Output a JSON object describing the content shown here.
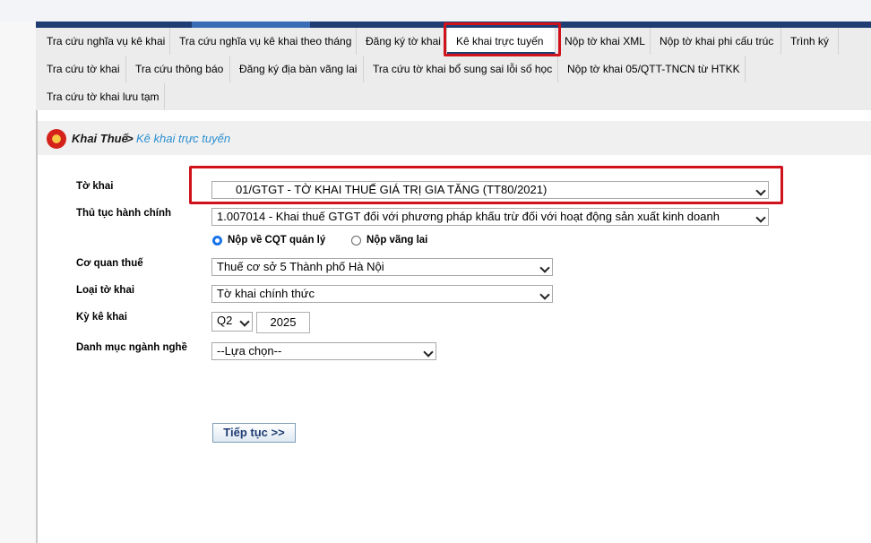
{
  "tabs_row1": [
    "Tra cứu nghĩa vụ kê khai",
    "Tra cứu nghĩa vụ kê khai theo tháng",
    "Đăng ký tờ khai",
    "Kê khai trực tuyến",
    "Nộp tờ khai XML",
    "Nộp tờ khai phi cấu trúc",
    "Trình ký"
  ],
  "tabs_row2": [
    "Tra cứu tờ khai",
    "Tra cứu thông báo",
    "Đăng ký địa bàn vãng lai",
    "Tra cứu tờ khai bổ sung sai lỗi số học",
    "Nộp tờ khai 05/QTT-TNCN từ HTKK"
  ],
  "tabs_row3": [
    "Tra cứu tờ khai lưu tạm"
  ],
  "breadcrumb": {
    "root": "Khai Thuế",
    "sep": ">",
    "current": "Kê khai trực tuyến"
  },
  "form": {
    "to_khai_label": "Tờ khai",
    "to_khai_value": "01/GTGT - TỜ KHAI THUẾ GIÁ TRỊ GIA TĂNG (TT80/2021)",
    "thu_tuc_label": "Thủ tục hành chính",
    "thu_tuc_value": "1.007014 - Khai thuế GTGT đối với phương pháp khấu trừ đối với hoạt động sản xuất kinh doanh",
    "radio_1": "Nộp về CQT quản lý",
    "radio_2": "Nộp vãng lai",
    "co_quan_label": "Cơ quan thuế",
    "co_quan_value": "Thuế cơ sở 5 Thành phố Hà Nội",
    "loai_label": "Loại tờ khai",
    "loai_value": "Tờ khai chính thức",
    "ky_label": "Kỳ kê khai",
    "ky_quarter": "Q2",
    "ky_year": "2025",
    "danh_muc_label": "Danh mục ngành nghề",
    "danh_muc_value": "--Lựa chọn--",
    "submit": "Tiếp tục >>"
  },
  "colors": {
    "nav_bar": "#1f3d73",
    "highlight_border": "#d0121c",
    "breadcrumb_link": "#2a8fd0",
    "radio_selected": "#1a73e8"
  }
}
